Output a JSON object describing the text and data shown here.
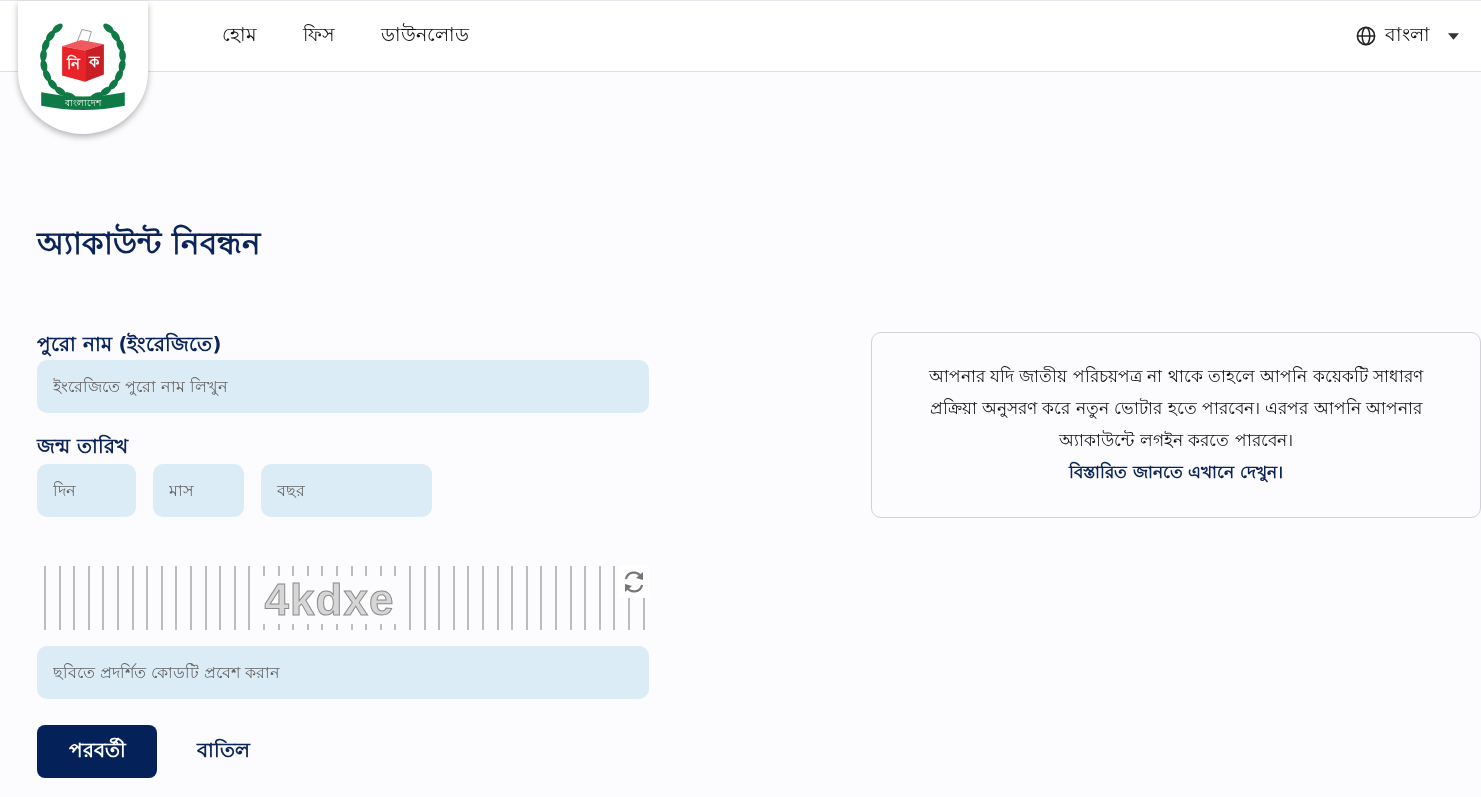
{
  "header": {
    "logo": {
      "box_letters": [
        "নি",
        "ক"
      ],
      "ribbon": "বাংলাদেশ"
    },
    "nav": [
      {
        "label": "হোম"
      },
      {
        "label": "ফিস"
      },
      {
        "label": "ডাউনলোড"
      }
    ],
    "language": {
      "label": "বাংলা"
    }
  },
  "title": "অ্যাকাউন্ট নিবন্ধন",
  "form": {
    "full_name": {
      "label": "পুরো নাম (ইংরেজিতে)",
      "placeholder": "ইংরেজিতে পুরো নাম লিখুন"
    },
    "birth_date": {
      "label": "জন্ম তারিখ",
      "parts": [
        {
          "placeholder": "দিন"
        },
        {
          "placeholder": "মাস"
        },
        {
          "placeholder": "বছর"
        }
      ]
    },
    "captcha": {
      "code": "4kdxe",
      "placeholder": "ছবিতে প্রদর্শিত কোডটি প্রবেশ করান"
    },
    "buttons": [
      {
        "label": "পরবর্তী",
        "kind": "primary"
      },
      {
        "label": "বাতিল",
        "kind": "plain"
      }
    ]
  },
  "info_card": {
    "text": "আপনার যদি জাতীয় পরিচয়পত্র না থাকে তাহলে আপনি কয়েকটি সাধারণ প্রক্রিয়া অনুসরণ করে নতুন ভোটার হতে পারবেন। এরপর আপনি আপনার অ্যাকাউন্টে লগইন করতে পারবেন।",
    "link": "বিস্তারিত জানতে এখানে দেখুন।"
  }
}
